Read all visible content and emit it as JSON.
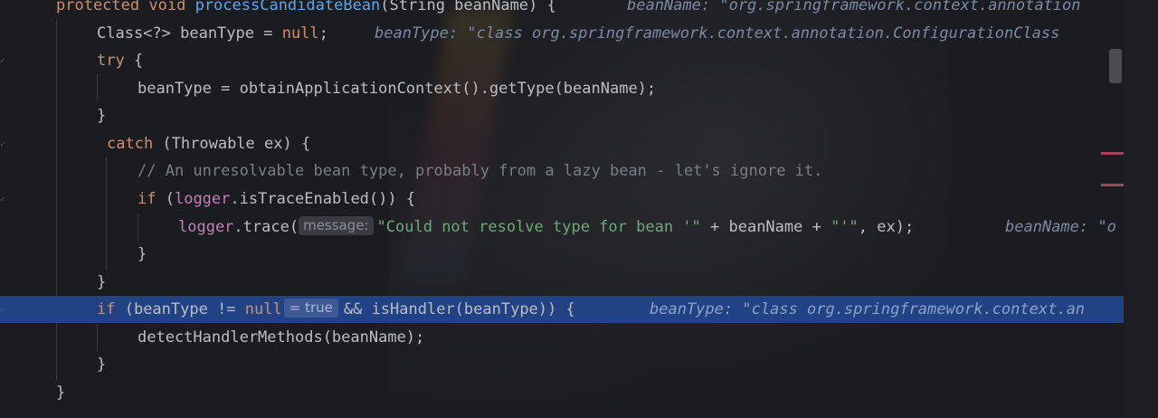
{
  "editor": {
    "colors": {
      "background": "#1b1c1f",
      "current_line": "#214283",
      "keyword": "#cf8e6d",
      "function": "#56a8f5",
      "string": "#6aab73",
      "comment": "#7a7e85",
      "field": "#c77dbb",
      "inlay_hint": "#7b8aa6",
      "error_stripe": "#c94f6d"
    },
    "lines": {
      "l1": {
        "kw1": "protected",
        "kw2": "void",
        "fn": "processCandidateBean",
        "rest": "(String beanName) {",
        "hint": "beanName: \"org.springframework.context.annotation"
      },
      "l2": {
        "text": "Class<?> beanType = ",
        "kw": "null",
        "rest": ";",
        "hint": "beanType: \"class org.springframework.context.annotation.ConfigurationClass"
      },
      "l3": {
        "kw": "try",
        "rest": " {"
      },
      "l4": {
        "text": "beanType = obtainApplicationContext().getType(beanName);"
      },
      "l5": {
        "text": "}"
      },
      "l6": {
        "kw": "catch",
        "rest": " (Throwable ex) {"
      },
      "l7": {
        "comment": "// An unresolvable bean type, probably from a lazy bean - let's ignore it."
      },
      "l8": {
        "kw": "if",
        "open": " (",
        "field": "logger",
        "rest": ".isTraceEnabled()) {"
      },
      "l9": {
        "field": "logger",
        "call": ".trace(",
        "param_hint": "message:",
        "str1": "\"Could not resolve type for bean '\"",
        "mid": " + beanName + ",
        "str2": "\"'\"",
        "end": ", ex);",
        "hint": "beanName: \"o"
      },
      "l10": {
        "text": "}"
      },
      "l11": {
        "text": "}"
      },
      "l12": {
        "kw": "if",
        "open": " (beanType != ",
        "kw_null": "null",
        "value_hint": "= true",
        "mid": "&& isHandler(beanType)) {",
        "hint": "beanType: \"class org.springframework.context.an"
      },
      "l13": {
        "text": "detectHandlerMethods(beanName);"
      },
      "l14": {
        "text": "}"
      },
      "l15": {
        "text": "}"
      }
    }
  }
}
